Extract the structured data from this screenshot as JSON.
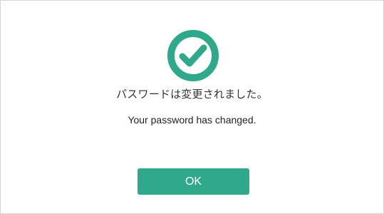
{
  "dialog": {
    "icon": "success-check-circle-icon",
    "message_ja": "パスワードは変更されました。",
    "message_en": "Your password has changed.",
    "ok_label": "OK"
  },
  "colors": {
    "accent": "#2fa88b",
    "text": "#333333",
    "border": "#d4d4d4"
  }
}
